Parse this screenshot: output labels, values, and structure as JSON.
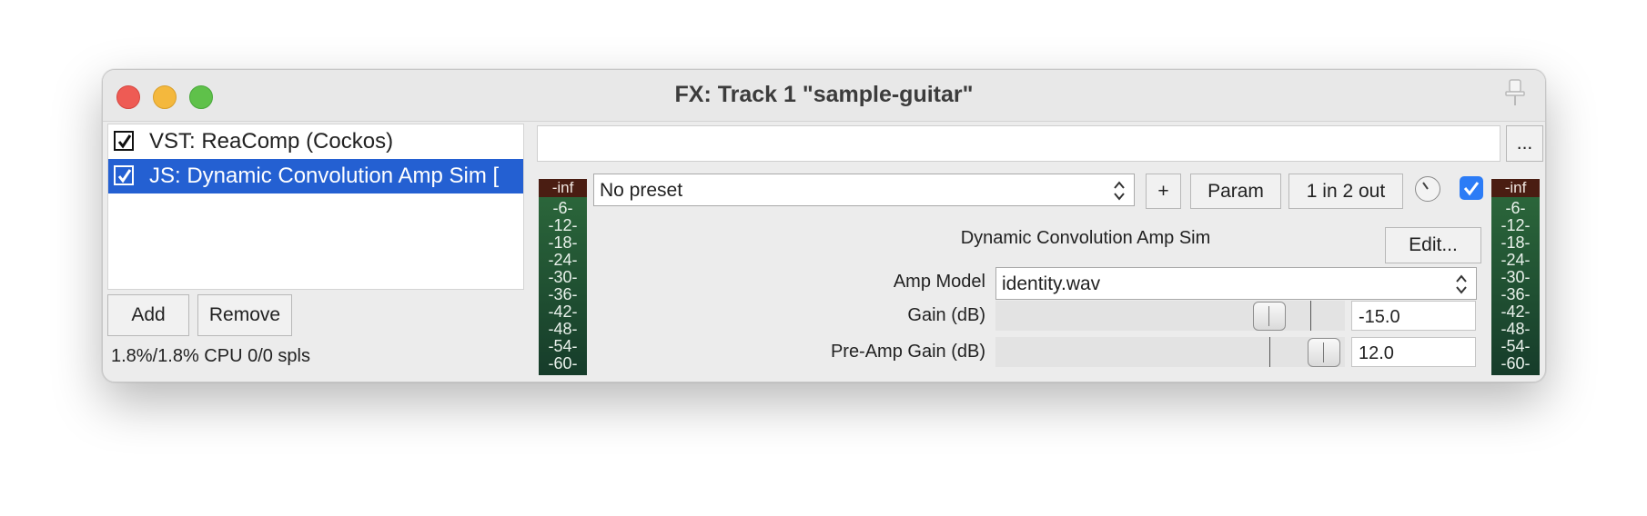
{
  "window": {
    "title": "FX: Track 1 \"sample-guitar\""
  },
  "fx_chain": {
    "items": [
      {
        "label": "VST: ReaComp (Cockos)",
        "enabled": true,
        "selected": false
      },
      {
        "label": "JS: Dynamic Convolution Amp Sim [",
        "enabled": true,
        "selected": true
      }
    ],
    "add_label": "Add",
    "remove_label": "Remove",
    "cpu_status": "1.8%/1.8% CPU 0/0 spls"
  },
  "toolbar": {
    "more_label": "...",
    "preset_value": "No preset",
    "add_preset_label": "+",
    "param_label": "Param",
    "io_label": "1 in 2 out",
    "bypass_enabled": true
  },
  "meters": {
    "peak_label": "-inf",
    "scale": [
      "-6-",
      "-12-",
      "-18-",
      "-24-",
      "-30-",
      "-36-",
      "-42-",
      "-48-",
      "-54-",
      "-60-"
    ]
  },
  "plugin": {
    "name": "Dynamic Convolution Amp Sim",
    "edit_label": "Edit...",
    "amp_model_label": "Amp Model",
    "amp_model_value": "identity.wav",
    "params": [
      {
        "label": "Gain (dB)",
        "value": "-15.0"
      },
      {
        "label": "Pre-Amp Gain (dB)",
        "value": "12.0"
      }
    ]
  },
  "colors": {
    "selection": "#2460d2",
    "meter_green": "#2d6a3c",
    "meter_peak": "#4a1d12",
    "checkbox_blue": "#2c7cf6"
  },
  "icons": [
    "close-icon",
    "minimize-icon",
    "zoom-icon",
    "pin-icon",
    "checkbox-icon",
    "updown-chevron-icon",
    "knob-icon"
  ]
}
